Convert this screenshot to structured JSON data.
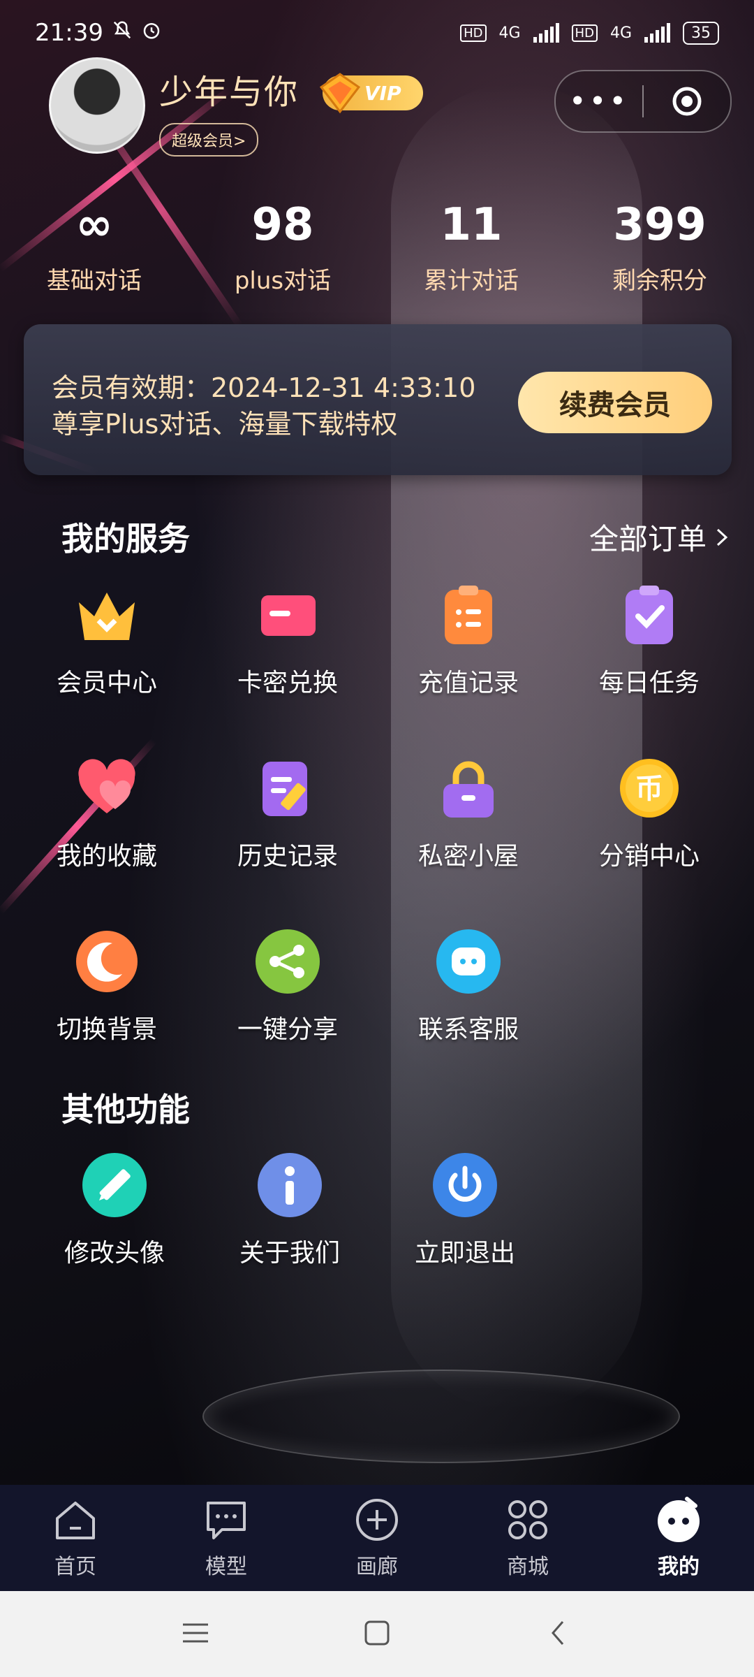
{
  "status_bar": {
    "time": "21:39",
    "network_1": "4G",
    "network_2": "4G",
    "battery": "35"
  },
  "profile": {
    "username": "少年与你",
    "vip_label": "VIP",
    "badge": "超级会员>"
  },
  "stats": [
    {
      "value": "∞",
      "label": "基础对话"
    },
    {
      "value": "98",
      "label": "plus对话"
    },
    {
      "value": "11",
      "label": "累计对话"
    },
    {
      "value": "399",
      "label": "剩余积分"
    }
  ],
  "membership": {
    "line1": "会员有效期：2024-12-31 4:33:10",
    "line2": "尊享Plus对话、海量下载特权",
    "renew_button": "续费会员"
  },
  "services": {
    "title": "我的服务",
    "all_orders": "全部订单",
    "items": [
      {
        "label": "会员中心",
        "icon": "crown-icon",
        "color": "#ffbf3c"
      },
      {
        "label": "卡密兑换",
        "icon": "card-icon",
        "color": "#ff4f7b"
      },
      {
        "label": "充值记录",
        "icon": "clipboard-list-icon",
        "color": "#ff8a3d"
      },
      {
        "label": "每日任务",
        "icon": "clipboard-check-icon",
        "color": "#b07cf5"
      },
      {
        "label": "我的收藏",
        "icon": "heart-icon",
        "color": "#ff5a6e"
      },
      {
        "label": "历史记录",
        "icon": "document-edit-icon",
        "color": "#a36af0"
      },
      {
        "label": "私密小屋",
        "icon": "lock-icon",
        "color": "#a26cf0"
      },
      {
        "label": "分销中心",
        "icon": "coin-icon",
        "color": "#ffbf1f"
      },
      {
        "label": "切换背景",
        "icon": "moon-icon",
        "color": "#ff7f42"
      },
      {
        "label": "一键分享",
        "icon": "share-icon",
        "color": "#86c640"
      },
      {
        "label": "联系客服",
        "icon": "chat-bubble-icon",
        "color": "#27b8f0"
      }
    ]
  },
  "other": {
    "title": "其他功能",
    "items": [
      {
        "label": "修改头像",
        "icon": "pencil-icon",
        "color": "#1fd1b6"
      },
      {
        "label": "关于我们",
        "icon": "info-icon",
        "color": "#6f8fe8"
      },
      {
        "label": "立即退出",
        "icon": "power-icon",
        "color": "#3d86e8"
      }
    ]
  },
  "tabbar": [
    {
      "label": "首页",
      "icon": "home-icon"
    },
    {
      "label": "模型",
      "icon": "message-icon"
    },
    {
      "label": "画廊",
      "icon": "plus-circle-icon"
    },
    {
      "label": "商城",
      "icon": "grid-icon"
    },
    {
      "label": "我的",
      "icon": "profile-face-icon",
      "active": true
    }
  ]
}
